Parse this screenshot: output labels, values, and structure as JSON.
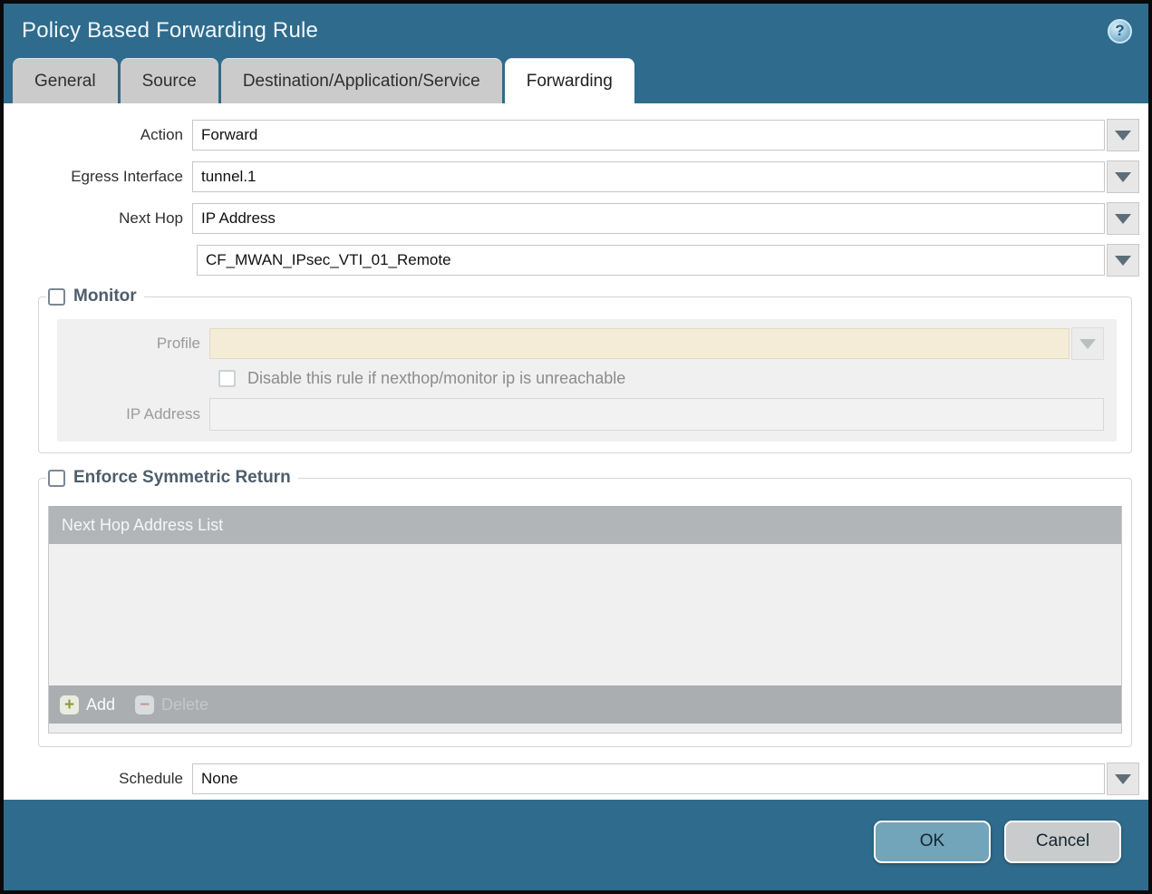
{
  "window": {
    "title": "Policy Based Forwarding Rule"
  },
  "icons": {
    "help": "?",
    "add": "+",
    "delete": "−"
  },
  "tabs": [
    {
      "label": "General",
      "active": false
    },
    {
      "label": "Source",
      "active": false
    },
    {
      "label": "Destination/Application/Service",
      "active": false
    },
    {
      "label": "Forwarding",
      "active": true
    }
  ],
  "form": {
    "action": {
      "label": "Action",
      "value": "Forward"
    },
    "egress_interface": {
      "label": "Egress Interface",
      "value": "tunnel.1"
    },
    "next_hop": {
      "label": "Next Hop",
      "value": "IP Address"
    },
    "next_hop_address": {
      "value": "CF_MWAN_IPsec_VTI_01_Remote"
    },
    "schedule": {
      "label": "Schedule",
      "value": "None"
    }
  },
  "monitor": {
    "legend": "Monitor",
    "checked": false,
    "profile": {
      "label": "Profile",
      "value": ""
    },
    "disable_rule": {
      "label": "Disable this rule if nexthop/monitor ip is unreachable",
      "checked": false
    },
    "ip_address": {
      "label": "IP Address",
      "value": ""
    }
  },
  "symmetric_return": {
    "legend": "Enforce Symmetric Return",
    "checked": false,
    "table": {
      "header": "Next Hop Address List",
      "rows": []
    },
    "add_label": "Add",
    "delete_label": "Delete"
  },
  "footer": {
    "ok_label": "OK",
    "cancel_label": "Cancel"
  },
  "colors": {
    "chrome_teal": "#2f6b8c",
    "tab_gray": "#cbcbcb",
    "legend_text": "#4d5d6b",
    "profile_field_beige": "#f5ecd7",
    "table_header_gray": "#b2b5b7",
    "ok_button": "#72a4ba",
    "cancel_button": "#c9cbcd",
    "add_icon_green": "#8a9b3a",
    "delete_icon_red": "#c79397"
  }
}
